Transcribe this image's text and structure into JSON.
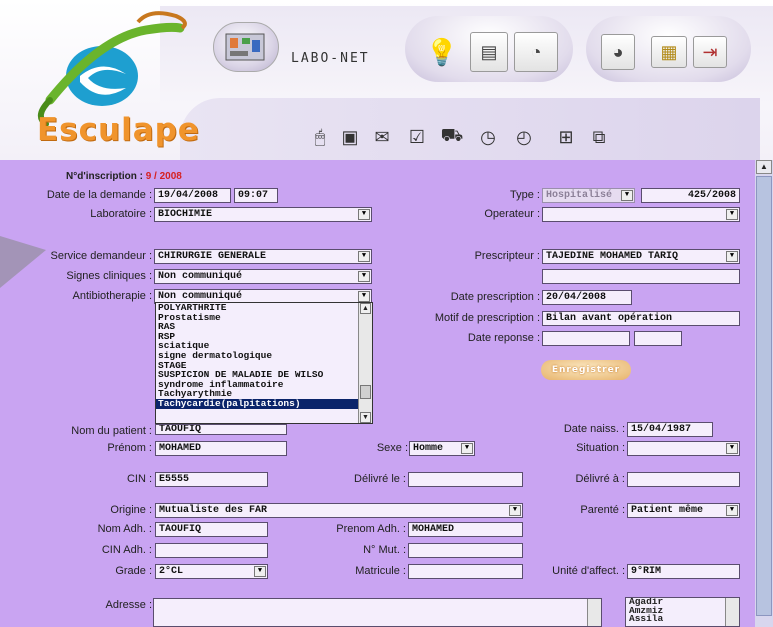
{
  "app": {
    "name": "Esculape",
    "module": "LABO-NET"
  },
  "header": {
    "top_icons": [
      "circuit-board-icon",
      "lightbulb-icon",
      "report-icon",
      "pie-chart-icon",
      "chip-icon",
      "exit-door-icon"
    ],
    "toolbar_icons": [
      "mouse-icon",
      "save-disk-icon",
      "mail-icon",
      "checklist-icon",
      "car-icon",
      "clock-icon",
      "network-icon",
      "folders-icon"
    ],
    "enregistrer": "Enregistrer"
  },
  "colors": {
    "form_bg": "#c9a4f2",
    "accent_orange": "#f0942c",
    "logo_blue": "#1e9fd0",
    "logo_green": "#6ab42c",
    "id_red": "#d62020"
  },
  "form": {
    "inscription_label": "N°d'inscription :",
    "inscription_value": "9 / 2008",
    "date_demande_label": "Date de la demande :",
    "date_demande": "19/04/2008",
    "heure_demande": "09:07",
    "type_label": "Type :",
    "type_value": "Hospitalisé",
    "type_number": "425/2008",
    "laboratoire_label": "Laboratoire :",
    "laboratoire": "BIOCHIMIE",
    "operateur_label": "Operateur :",
    "operateur": "",
    "service_label": "Service demandeur :",
    "service": "CHIRURGIE GENERALE",
    "prescripteur_label": "Prescripteur :",
    "prescripteur": "TAJEDINE MOHAMED TARIQ",
    "signes_label": "Signes cliniques :",
    "signes": "Non communiqué",
    "antibio_label": "Antibiotherapie :",
    "antibio": "Non communiqué",
    "date_prescription_label": "Date prescription :",
    "date_prescription": "20/04/2008",
    "motif_label": "Motif de prescription :",
    "motif": "Bilan avant opération",
    "date_reponse_label": "Date reponse :",
    "date_reponse": "",
    "dropdown_items": [
      "POLYARTHRITE",
      "Prostatisme",
      "RAS",
      "RSP",
      "sciatique",
      "signe dermatologique",
      "STAGE",
      "SUSPICION DE MALADIE DE WILSO",
      "syndrome inflammatoire",
      "Tachyarythmie",
      "Tachycardie(palpitations)"
    ],
    "dropdown_selected": "Tachycardie(palpitations)",
    "nom_label": "Nom du patient :",
    "nom": "TAOUFIQ",
    "date_naiss_label": "Date naiss. :",
    "date_naiss": "15/04/1987",
    "prenom_label": "Prénom :",
    "prenom": "MOHAMED",
    "sexe_label": "Sexe :",
    "sexe": "Homme",
    "situation_label": "Situation :",
    "situation": "",
    "cin_label": "CIN :",
    "cin": "E5555",
    "delivre_le_label": "Délivré le :",
    "delivre_le": "",
    "delivre_a_label": "Délivré à :",
    "delivre_a": "",
    "origine_label": "Origine :",
    "origine": "Mutualiste des FAR",
    "parente_label": "Parenté :",
    "parente": "Patient même",
    "nom_adh_label": "Nom Adh. :",
    "nom_adh": "TAOUFIQ",
    "prenom_adh_label": "Prenom Adh. :",
    "prenom_adh": "MOHAMED",
    "cin_adh_label": "CIN Adh. :",
    "cin_adh": "",
    "n_mut_label": "N° Mut. :",
    "n_mut": "",
    "grade_label": "Grade :",
    "grade": "2°CL",
    "matricule_label": "Matricule :",
    "matricule": "",
    "unite_label": "Unité d'affect. :",
    "unite": "9°RIM",
    "adresse_label": "Adresse :",
    "adresse": "",
    "cities": [
      "Agadir",
      "Amzmiz",
      "Assila"
    ]
  }
}
